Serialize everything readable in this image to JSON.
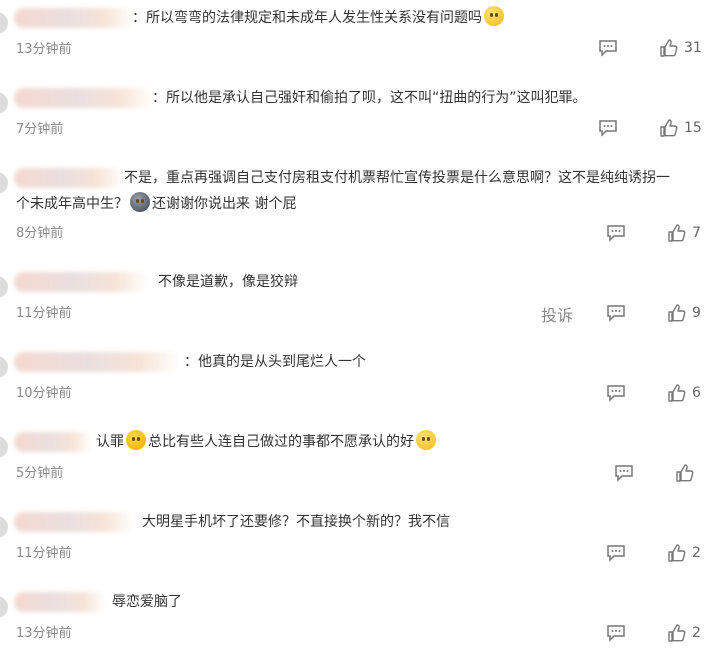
{
  "comments": [
    {
      "text_a": "：所以弯弯的法律规定和未成年人发生性关系没有问题吗",
      "time": "13分钟前",
      "likes": "31"
    },
    {
      "text_a": "：所以他是承认自己强奸和偷拍了呗，这不叫“扭曲的行为”这叫犯罪。",
      "time": "7分钟前",
      "likes": "15"
    },
    {
      "text_a": "不是，重点再强调自己支付房租支付机票帮忙宣传投票是什么意思啊？这不是纯纯诱拐一",
      "text_b": "个未成年高中生？",
      "text_c": "还谢谢你说出来 谢个屁",
      "time": "8分钟前",
      "likes": "7"
    },
    {
      "text_a": "不像是道歉，像是狡辩",
      "time": "11分钟前",
      "likes": "9",
      "report_label": "投诉"
    },
    {
      "text_a": "：他真的是从头到尾烂人一个",
      "time": "10分钟前",
      "likes": "6"
    },
    {
      "text_a": "认罪",
      "text_b": "总比有些人连自己做过的事都不愿承认的好",
      "time": "5分钟前",
      "likes": ""
    },
    {
      "text_a": "大明星手机坏了还要修？不直接换个新的？我不信",
      "time": "11分钟前",
      "likes": "2"
    },
    {
      "text_a": "辱恋爱脑了",
      "time": "13分钟前",
      "likes": "2"
    }
  ],
  "icons": {
    "reply": "reply-bubble-icon",
    "like": "thumbs-up-icon",
    "emoji": "emoji-face-icon"
  },
  "colors": {
    "text": "#333333",
    "meta": "#8a8a8a",
    "icon": "#777777"
  }
}
